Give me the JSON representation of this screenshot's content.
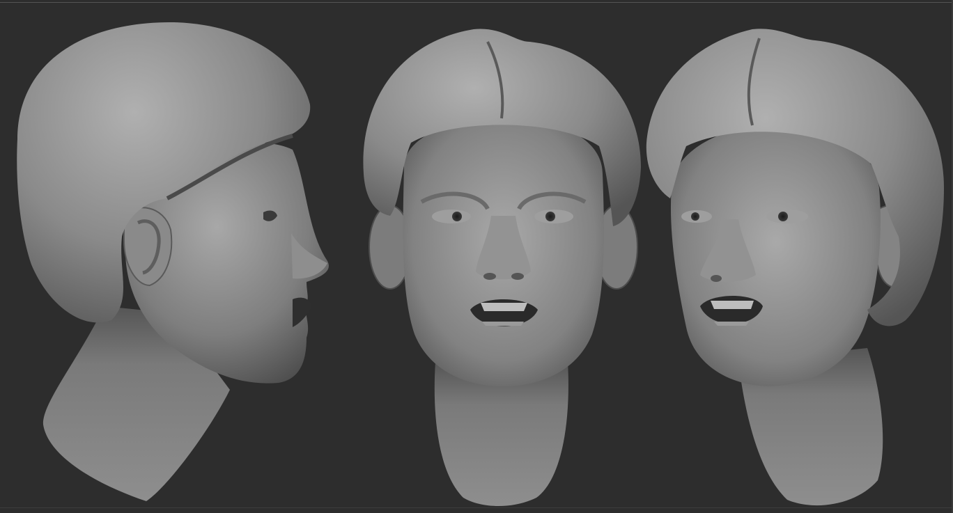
{
  "app": {
    "title": ""
  },
  "viewport": {
    "background_color": "#2d2d2d",
    "material_color": "#8c8c8c",
    "views": [
      {
        "view": "profile-left"
      },
      {
        "view": "front"
      },
      {
        "view": "three-quarter-right"
      }
    ]
  }
}
